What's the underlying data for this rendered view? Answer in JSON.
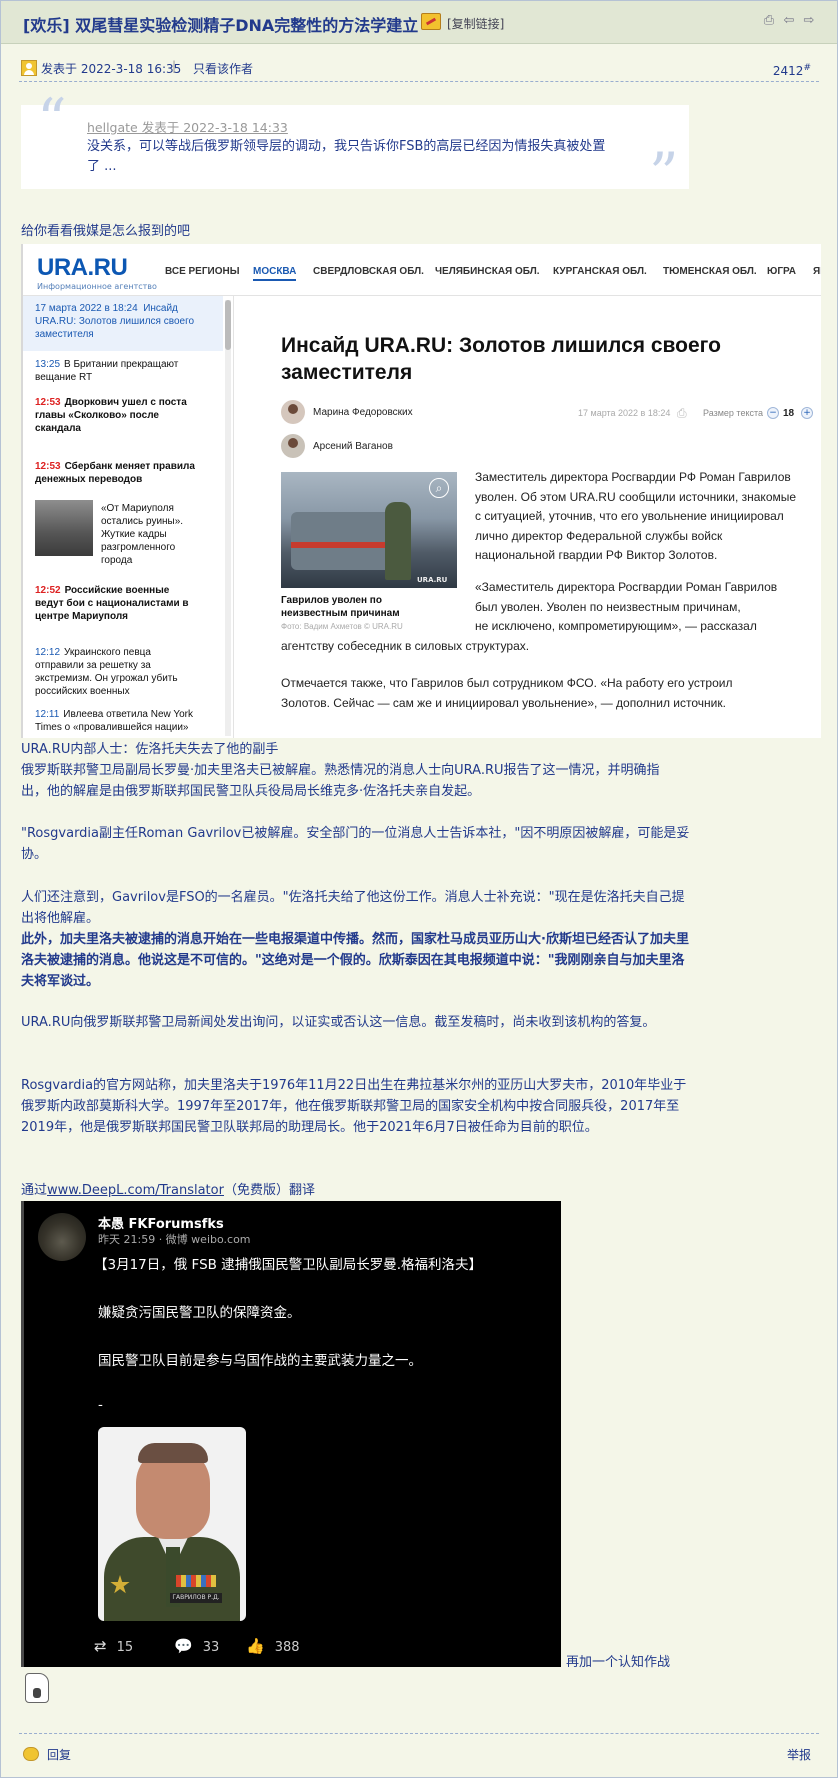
{
  "header": {
    "title": "[欢乐] 双尾彗星实验检测精子DNA完整性的方法学建立",
    "copy_link": "[复制链接]",
    "icons": [
      "print-icon",
      "prev-thread-icon",
      "next-thread-icon"
    ]
  },
  "post": {
    "posted_at": "发表于 2022-3-18 16:35",
    "only_author": "只看该作者",
    "floor": "2412",
    "floor_mark": "#",
    "quote": {
      "author_line": "hellgate 发表于 2022-3-18 14:33",
      "text": "没关系，可以等战后俄罗斯领导层的调动，我只告诉你FSB的高层已经因为情报失真被处置了 ..."
    },
    "intro": "给你看看俄媒是怎么报到的吧",
    "translation": {
      "title": "URA.RU内部人士：佐洛托夫失去了他的副手",
      "p1": "俄罗斯联邦警卫局副局长罗曼·加夫里洛夫已被解雇。熟悉情况的消息人士向URA.RU报告了这一情况，并明确指出，他的解雇是由俄罗斯联邦国民警卫队兵役局局长维克多·佐洛托夫亲自发起。",
      "p2": "\"Rosgvardia副主任Roman Gavrilov已被解雇。安全部门的一位消息人士告诉本社，\"因不明原因被解雇，可能是妥协。",
      "p3": "人们还注意到，Gavrilov是FSO的一名雇员。\"佐洛托夫给了他这份工作。消息人士补充说：\"现在是佐洛托夫自己提出将他解雇。",
      "p4_bold": "此外，加夫里洛夫被逮捕的消息开始在一些电报渠道中传播。然而，国家杜马成员亚历山大·欣斯坦已经否认了加夫里洛夫被逮捕的消息。他说这是不可信的。\"这绝对是一个假的。欣斯泰因在其电报频道中说：\"我刚刚亲自与加夫里洛夫将军谈过。",
      "p5": "URA.RU向俄罗斯联邦警卫局新闻处发出询问，以证实或否认这一信息。截至发稿时，尚未收到该机构的答复。",
      "p6": "Rosgvardia的官方网站称，加夫里洛夫于1976年11月22日出生在弗拉基米尔州的亚历山大罗夫市，2010年毕业于俄罗斯内政部莫斯科大学。1997年至2017年，他在俄罗斯联邦警卫局的国家安全机构中按合同服兵役，2017年至2019年，他是俄罗斯联邦国民警卫队联邦局的助理局长。他于2021年6月7日被任命为目前的职位。",
      "deepl_prefix": "通过",
      "deepl_link": "www.DeepL.com/Translator",
      "deepl_suffix": "（免费版）翻译"
    },
    "after_image_link": "再加一个认知作战"
  },
  "ura": {
    "logo": "URA.RU",
    "tagline": "Информационное агентство",
    "nav": [
      "ВСЕ РЕГИОНЫ",
      "МОСКВА",
      "СВЕРДЛОВСКАЯ ОБЛ.",
      "ЧЕЛЯБИНСКАЯ ОБЛ.",
      "КУРГАНСКАЯ ОБЛ.",
      "ТЮМЕНСКАЯ ОБЛ.",
      "ЮГРА",
      "ЯМ"
    ],
    "sidebar": [
      {
        "time": "17 марта 2022 в 18:24",
        "text": "Инсайд URA.RU: Золотов лишился своего заместителя"
      },
      {
        "time": "13:25",
        "text": "В Британии прекращают вещание RT"
      },
      {
        "time": "12:53",
        "text": "Дворкович ушел с поста главы «Сколково» после скандала"
      },
      {
        "time": "12:53",
        "text": "Сбербанк меняет правила денежных переводов"
      },
      {
        "time": "",
        "text": "«От Мариуполя остались руины». Жуткие кадры разгромленного города"
      },
      {
        "time": "12:52",
        "text": "Российские военные ведут бои с националистами в центре Мариуполя"
      },
      {
        "time": "12:12",
        "text": "Украинского певца отправили за решетку за экстремизм. Он угрожал убить российских военных"
      },
      {
        "time": "12:11",
        "text": "Ивлеева ответила New York Times о «провалившейся нации»"
      }
    ],
    "headline": "Инсайд URA.RU: Золотов лишился своего заместителя",
    "authors": [
      "Марина Федоровских",
      "Арсений Ваганов"
    ],
    "date": "17 марта 2022 в 18:24",
    "text_size_label": "Размер текста",
    "text_size_value": "18",
    "photo_mark": "URA.RU",
    "caption": "Гаврилов уволен по неизвестным причинам",
    "photo_credit": "Фото: Вадим Ахметов © URA.RU",
    "body1": [
      "Заместитель директора Росгвардии РФ Роман Гаврилов",
      "уволен. Об этом URA.RU сообщили источники, знакомые",
      "с ситуацией, уточнив, что его увольнение инициировал",
      "лично директор Федеральной службы войск",
      "национальной гвардии РФ Виктор Золотов."
    ],
    "body2": [
      "«Заместитель директора Росгвардии Роман Гаврилов",
      "был уволен. Уволен по неизвестным причинам,",
      "не исключено, компрометирующим», — рассказал"
    ],
    "body2_tail": "агентству собеседник в силовых структурах.",
    "body3": [
      "Отмечается также, что Гаврилов был сотрудником ФСО. «На работу его устроил",
      "Золотов. Сейчас — сам же и инициировал увольнение», — дополнил источник."
    ]
  },
  "weibo": {
    "name": "本愚 FKForumsfks",
    "sub": "昨天 21:59 · 微博 weibo.com",
    "line1": "【3月17日，俄 FSB 逮捕俄国民警卫队副局长罗曼.格福利洛夫】",
    "line2": "嫌疑贪污国民警卫队的保障资金。",
    "line3": "国民警卫队目前是参与乌国作战的主要武装力量之一。",
    "line4": "-",
    "photo_tag": "ГАВРИЛОВ Р.Д.",
    "reposts": "15",
    "comments": "33",
    "likes": "388"
  },
  "footer": {
    "reply": "回复",
    "report": "举报"
  }
}
